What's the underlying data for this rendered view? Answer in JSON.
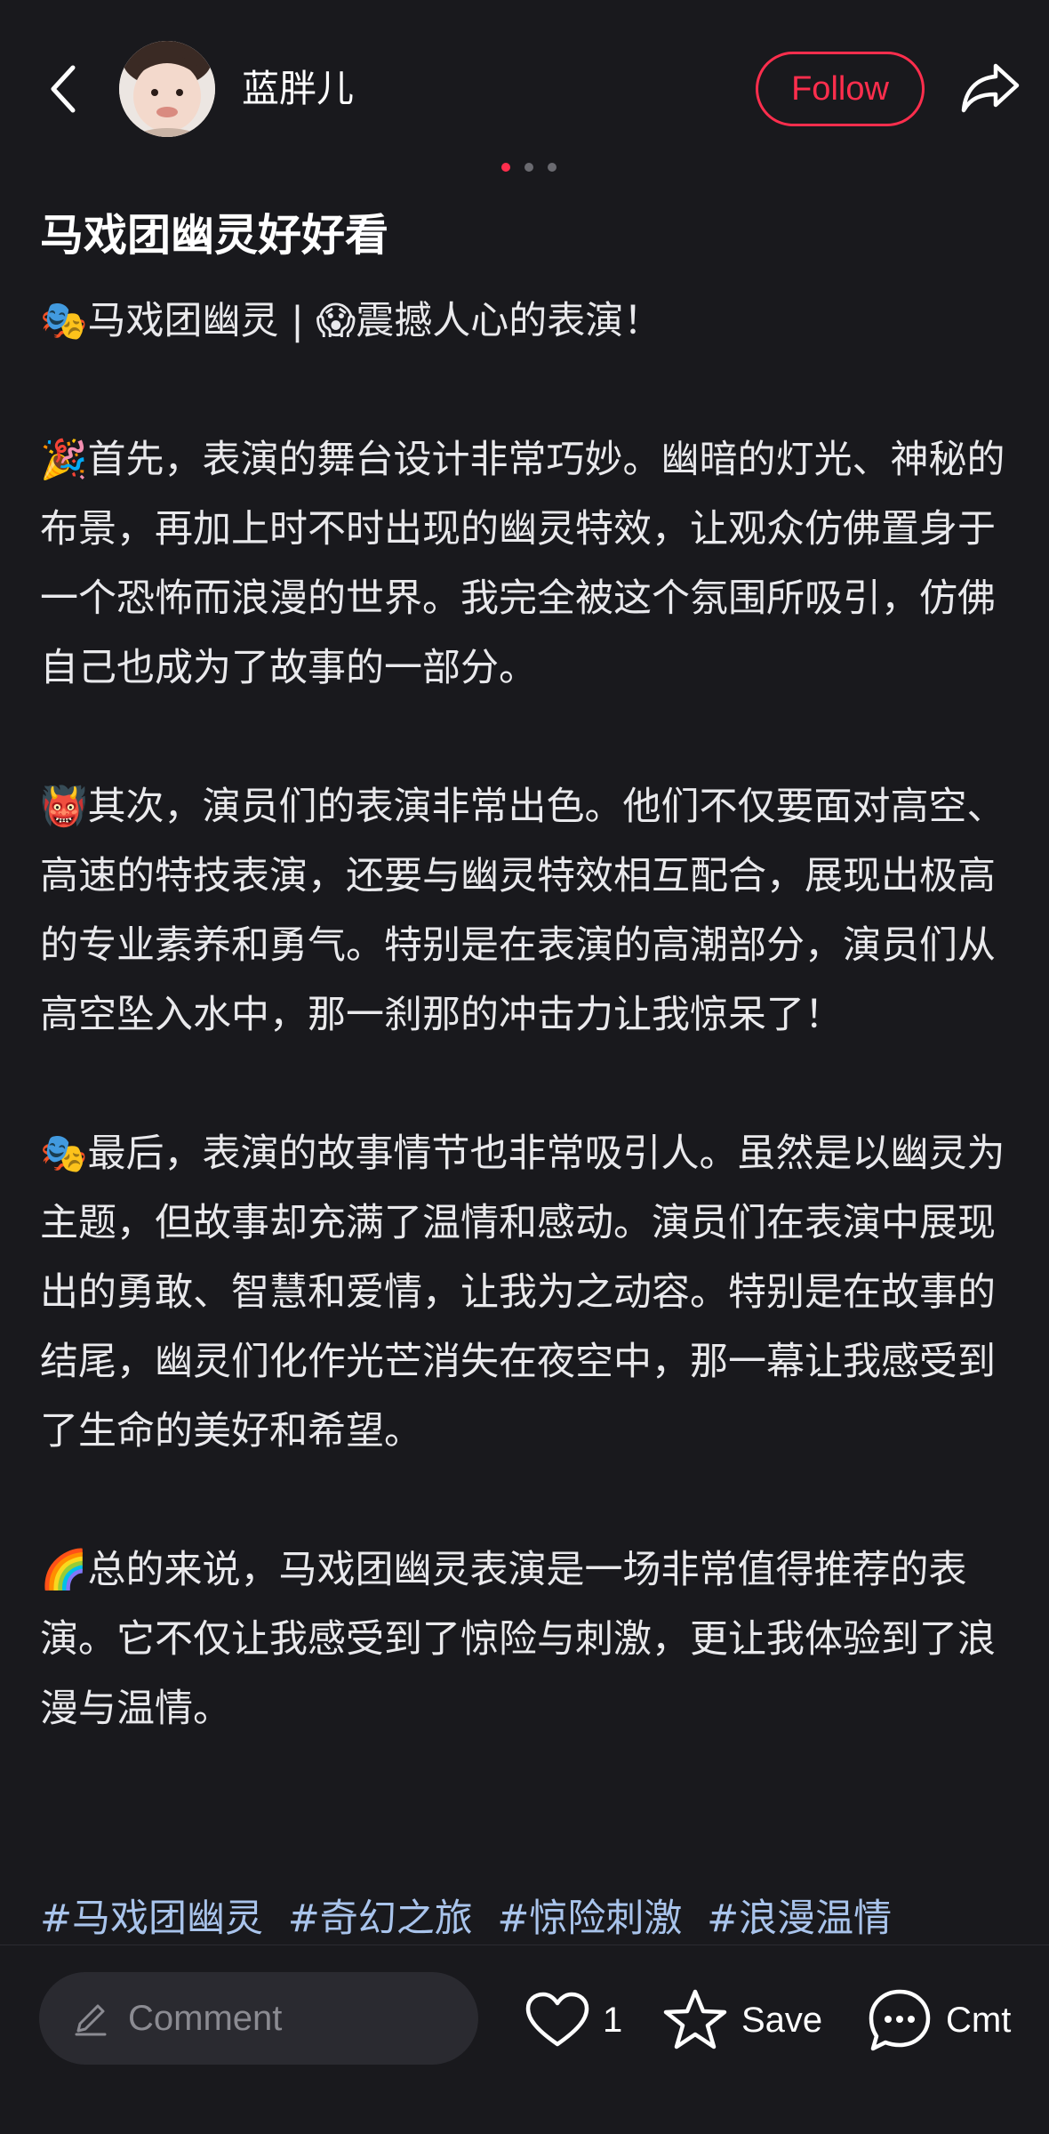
{
  "header": {
    "author_name": "蓝胖儿",
    "follow_label": "Follow"
  },
  "carousel": {
    "count": 3,
    "active_index": 0
  },
  "post": {
    "title": "马戏团幽灵好好看",
    "paragraphs": [
      "🎭马戏团幽灵 | 😱震撼人心的表演！",
      "🎉首先，表演的舞台设计非常巧妙。幽暗的灯光、神秘的布景，再加上时不时出现的幽灵特效，让观众仿佛置身于一个恐怖而浪漫的世界。我完全被这个氛围所吸引，仿佛自己也成为了故事的一部分。",
      "👹其次，演员们的表演非常出色。他们不仅要面对高空、高速的特技表演，还要与幽灵特效相互配合，展现出极高的专业素养和勇气。特别是在表演的高潮部分，演员们从高空坠入水中，那一刹那的冲击力让我惊呆了！",
      "🎭最后，表演的故事情节也非常吸引人。虽然是以幽灵为主题，但故事却充满了温情和感动。演员们在表演中展现出的勇敢、智慧和爱情，让我为之动容。特别是在故事的结尾，幽灵们化作光芒消失在夜空中，那一幕让我感受到了生命的美好和希望。",
      "🌈总的来说，马戏团幽灵表演是一场非常值得推荐的表演。它不仅让我感受到了惊险与刺激，更让我体验到了浪漫与温情。"
    ],
    "hashtags": [
      "#马戏团幽灵",
      "#奇幻之旅",
      "#惊险刺激",
      "#浪漫温情"
    ]
  },
  "bottom_bar": {
    "comment_placeholder": "Comment",
    "like_count": "1",
    "save_label": "Save",
    "comment_label": "Cmt"
  },
  "colors": {
    "background": "#19191d",
    "accent": "#ff2e4d",
    "hashtag": "#a9c4ec"
  }
}
